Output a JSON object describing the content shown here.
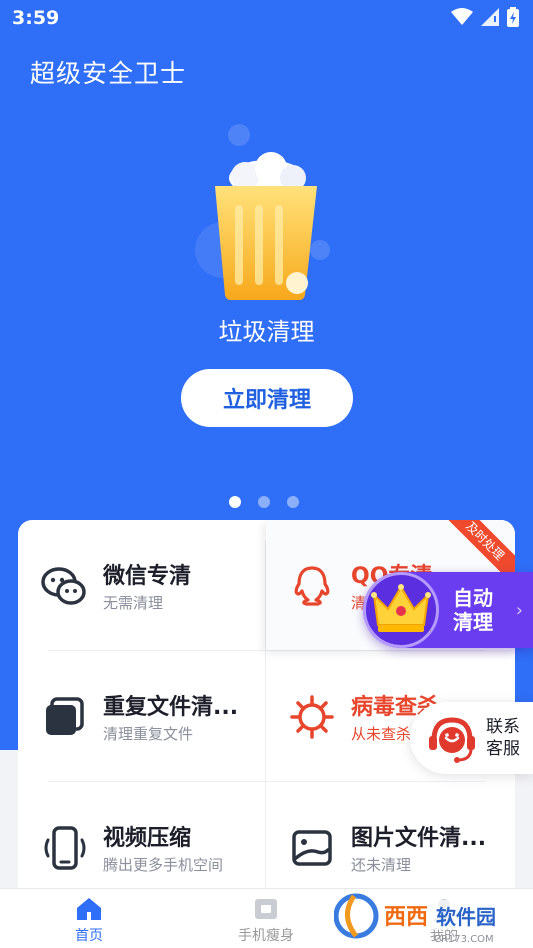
{
  "status": {
    "time": "3:59"
  },
  "app": {
    "title": "超级安全卫士"
  },
  "hero": {
    "label": "垃圾清理",
    "button_label": "立即清理",
    "page_count": 3,
    "active_page": 1
  },
  "tiles": [
    {
      "title": "微信专清",
      "subtitle": "无需清理",
      "icon": "wechat-icon"
    },
    {
      "title": "QQ专清",
      "subtitle": "清",
      "icon": "qq-icon",
      "badge": "及时处理"
    },
    {
      "title": "重复文件清...",
      "subtitle": "清理重复文件",
      "icon": "duplicate-files-icon"
    },
    {
      "title": "病毒查杀",
      "subtitle": "从未查杀",
      "icon": "virus-icon"
    },
    {
      "title": "视频压缩",
      "subtitle": "腾出更多手机空间",
      "icon": "video-phone-icon"
    },
    {
      "title": "图片文件清...",
      "subtitle": "还未清理",
      "icon": "image-file-icon"
    }
  ],
  "auto_clean": {
    "line1": "自动",
    "line2": "清理"
  },
  "support": {
    "line1": "联系",
    "line2": "客服"
  },
  "nav": [
    {
      "label": "首页",
      "icon": "home-icon",
      "active": true
    },
    {
      "label": "手机瘦身",
      "icon": "slim-icon",
      "active": false
    },
    {
      "label": "我的",
      "icon": "profile-icon",
      "active": false
    }
  ],
  "watermark": {
    "text": "西西软件园",
    "url_text": "CR173.COM"
  },
  "colors": {
    "primary": "#2f6ef6",
    "accent_red": "#e8462c",
    "purple": "#6a3df0"
  }
}
